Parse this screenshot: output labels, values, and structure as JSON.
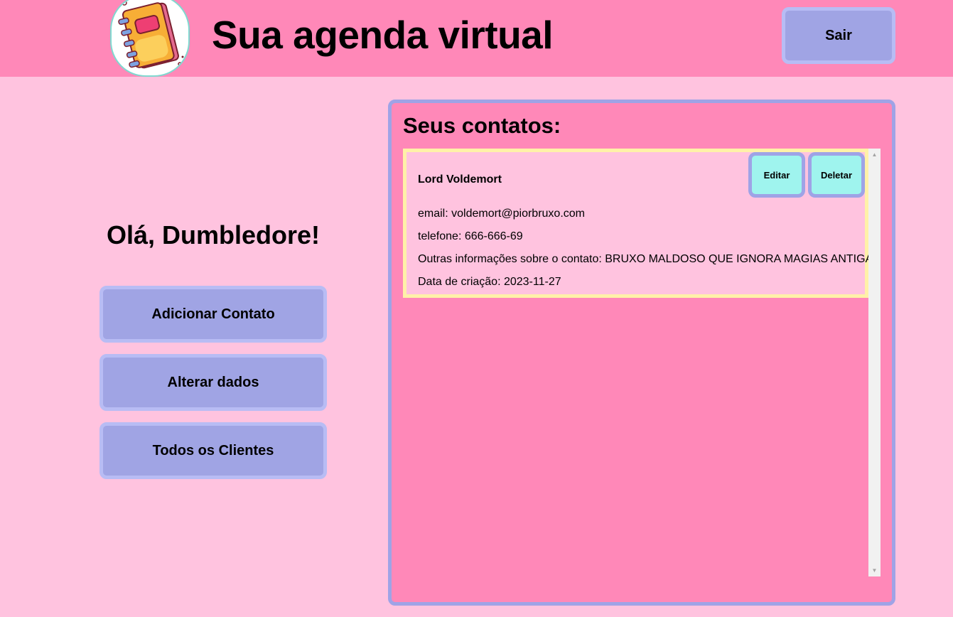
{
  "header": {
    "title": "Sua agenda virtual",
    "exit_label": "Sair",
    "logo_icon": "notebook-icon"
  },
  "sidebar": {
    "greeting": "Olá, Dumbledore!",
    "buttons": [
      {
        "label": "Adicionar Contato"
      },
      {
        "label": "Alterar dados"
      },
      {
        "label": "Todos os Clientes"
      }
    ]
  },
  "contacts_panel": {
    "title": "Seus contatos:",
    "contacts": [
      {
        "name": "Lord Voldemort",
        "email": "email: voldemort@piorbruxo.com",
        "phone": "telefone: 666-666-69",
        "info": "Outras informações sobre o contato: BRUXO MALDOSO QUE IGNORA MAGIAS ANTIGAS",
        "created": "Data de criação: 2023-11-27",
        "edit_label": "Editar",
        "delete_label": "Deletar"
      }
    ]
  },
  "colors": {
    "background": "#ffc3df",
    "header": "#ff88b8",
    "button": "#a0a4e4",
    "button_border": "#b8bcf4",
    "card_border": "#fff1a8",
    "card_button": "#9ff4ee"
  }
}
